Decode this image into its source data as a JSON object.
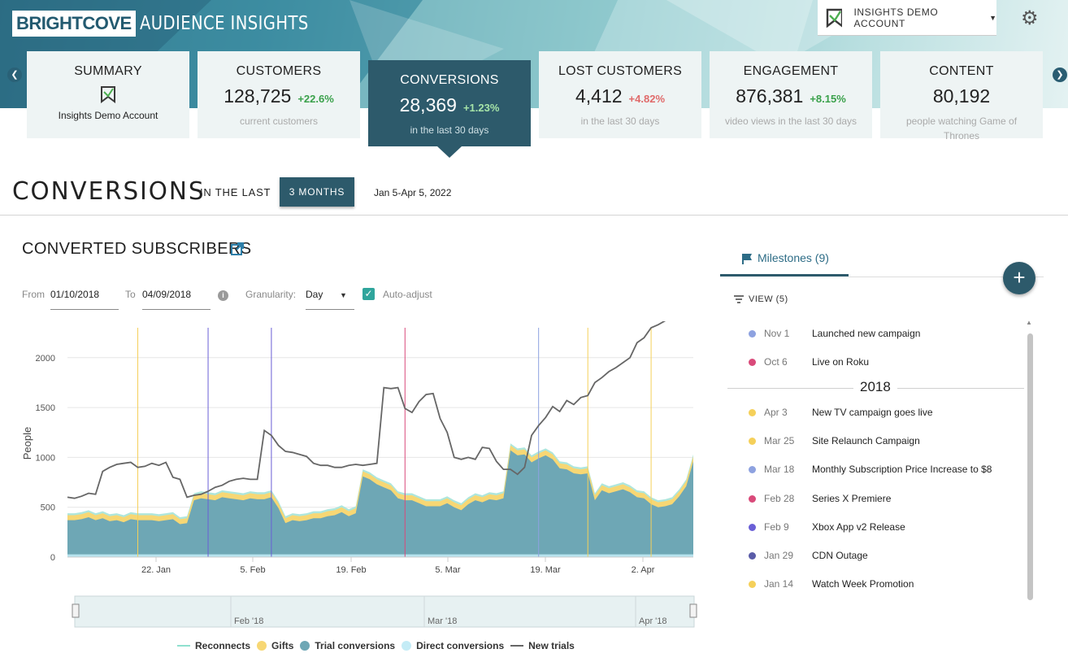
{
  "app": {
    "logo_brand": "BRIGHTCOVE",
    "logo_product": "AUDIENCE INSIGHTS",
    "account_label": "INSIGHTS DEMO ACCOUNT"
  },
  "cards": [
    {
      "title": "SUMMARY",
      "name": "Insights Demo Account"
    },
    {
      "title": "CUSTOMERS",
      "value": "128,725",
      "delta": "+22.6%",
      "sub": "current customers"
    },
    {
      "title": "CONVERSIONS",
      "value": "28,369",
      "delta": "+1.23%",
      "sub": "in the last 30 days"
    },
    {
      "title": "LOST CUSTOMERS",
      "value": "4,412",
      "delta": "+4.82%",
      "sub": "in the last 30 days"
    },
    {
      "title": "ENGAGEMENT",
      "value": "876,381",
      "delta": "+8.15%",
      "sub": "video views in the last 30 days"
    },
    {
      "title": "CONTENT",
      "value": "80,192",
      "sub": "people watching Game of Thrones"
    }
  ],
  "section": {
    "title": "CONVERSIONS",
    "in_the_last": "IN THE LAST",
    "period_button": "3 MONTHS",
    "date_range": "Jan 5-Apr 5, 2022"
  },
  "panel": {
    "title": "CONVERTED SUBSCRIBERS",
    "from_label": "From",
    "from_value": "01/10/2018",
    "to_label": "To",
    "to_value": "04/09/2018",
    "granularity_label": "Granularity:",
    "granularity_value": "Day",
    "auto_adjust_label": "Auto-adjust",
    "auto_adjust_checked": true
  },
  "chart_data": {
    "type": "area",
    "ylabel": "People",
    "ylim": [
      0,
      2300
    ],
    "y_ticks": [
      "0",
      "500",
      "1000",
      "1500",
      "2000"
    ],
    "x_ticks": [
      "22. Jan",
      "5. Feb",
      "19. Feb",
      "5. Mar",
      "19. Mar",
      "2. Apr"
    ],
    "navigator_labels": [
      "Feb '18",
      "Mar '18",
      "Apr '18"
    ],
    "x_start": "2018-01-10",
    "series": [
      {
        "name": "Reconnects",
        "color": "#aee6dc",
        "values": [
          20,
          20,
          20,
          20,
          20,
          20,
          20,
          20,
          20,
          20,
          20,
          20,
          20,
          20,
          20,
          20,
          20,
          20,
          20,
          20,
          20,
          20,
          20,
          20,
          20,
          20,
          20,
          20,
          20,
          20,
          20,
          20,
          20,
          20,
          20,
          20,
          20,
          20,
          20,
          20,
          20,
          20,
          20,
          20,
          20,
          20,
          20,
          20,
          20,
          20,
          20,
          20,
          20,
          20,
          20,
          20,
          20,
          20,
          20,
          20,
          20,
          20,
          20,
          20,
          20,
          20,
          20,
          20,
          20,
          20,
          20,
          20,
          20,
          20,
          20,
          20,
          20,
          20,
          20,
          20,
          20,
          20,
          20,
          20,
          20,
          20,
          20,
          20,
          20,
          20
        ]
      },
      {
        "name": "Gifts",
        "color": "#f7d774",
        "values": [
          50,
          50,
          50,
          50,
          50,
          50,
          50,
          50,
          50,
          50,
          50,
          50,
          50,
          50,
          50,
          50,
          50,
          50,
          50,
          50,
          50,
          50,
          50,
          50,
          50,
          50,
          50,
          50,
          50,
          50,
          50,
          50,
          50,
          50,
          50,
          50,
          50,
          50,
          50,
          50,
          50,
          50,
          50,
          50,
          50,
          50,
          50,
          50,
          50,
          50,
          50,
          50,
          50,
          50,
          50,
          50,
          50,
          50,
          50,
          50,
          50,
          50,
          50,
          50,
          50,
          50,
          50,
          50,
          50,
          50,
          50,
          50,
          50,
          50,
          50,
          50,
          50,
          50,
          50,
          50,
          50,
          50,
          50,
          50,
          50,
          50,
          50,
          50,
          50,
          50
        ]
      },
      {
        "name": "Trial conversions",
        "color": "#6ea7b5",
        "values": [
          360,
          360,
          370,
          390,
          360,
          380,
          350,
          360,
          340,
          370,
          360,
          360,
          360,
          350,
          360,
          370,
          320,
          330,
          560,
          580,
          570,
          560,
          590,
          580,
          570,
          560,
          580,
          570,
          570,
          590,
          480,
          330,
          360,
          350,
          360,
          380,
          380,
          400,
          410,
          440,
          400,
          430,
          800,
          770,
          720,
          690,
          660,
          580,
          560,
          560,
          530,
          500,
          500,
          500,
          530,
          490,
          460,
          520,
          560,
          540,
          570,
          560,
          580,
          1060,
          1010,
          1020,
          940,
          980,
          1010,
          970,
          880,
          870,
          830,
          820,
          830,
          560,
          660,
          630,
          650,
          670,
          640,
          590,
          580,
          520,
          490,
          500,
          520,
          600,
          700,
          950
        ]
      },
      {
        "name": "Direct conversions",
        "color": "#b7e3ee",
        "values": [
          10,
          10,
          10,
          10,
          10,
          10,
          10,
          10,
          10,
          10,
          10,
          10,
          10,
          10,
          10,
          10,
          10,
          10,
          10,
          10,
          10,
          10,
          10,
          10,
          10,
          10,
          10,
          10,
          10,
          10,
          10,
          10,
          10,
          10,
          10,
          10,
          10,
          10,
          10,
          10,
          10,
          10,
          10,
          10,
          10,
          10,
          10,
          10,
          10,
          10,
          10,
          10,
          10,
          10,
          10,
          10,
          10,
          10,
          10,
          10,
          10,
          10,
          10,
          10,
          10,
          10,
          10,
          10,
          10,
          10,
          10,
          10,
          10,
          10,
          10,
          10,
          10,
          10,
          10,
          10,
          10,
          10,
          10,
          10,
          10,
          10,
          10,
          10,
          10,
          10
        ]
      },
      {
        "name": "New trials",
        "color": "#666666",
        "values": [
          600,
          590,
          610,
          640,
          630,
          860,
          900,
          930,
          940,
          950,
          900,
          910,
          940,
          920,
          950,
          800,
          780,
          600,
          620,
          630,
          660,
          700,
          720,
          760,
          780,
          790,
          780,
          780,
          1270,
          1220,
          1120,
          1060,
          1050,
          1030,
          1010,
          940,
          920,
          920,
          900,
          900,
          920,
          930,
          920,
          930,
          940,
          1700,
          1690,
          1700,
          1490,
          1450,
          1560,
          1630,
          1640,
          1390,
          1250,
          1000,
          980,
          1000,
          980,
          1100,
          1090,
          960,
          880,
          880,
          830,
          900,
          1220,
          1320,
          1400,
          1510,
          1460,
          1570,
          1530,
          1600,
          1620,
          1750,
          1800,
          1860,
          1900,
          1950,
          2000,
          2150,
          2200,
          2300,
          2330,
          2370,
          2420,
          2460,
          2520,
          2570
        ]
      }
    ],
    "milestone_lines": [
      {
        "color": "#f5d05a",
        "x_index": 10
      },
      {
        "color": "#6a5fd6",
        "x_index": 20
      },
      {
        "color": "#6a5fd6",
        "x_index": 29
      },
      {
        "color": "#d94a7a",
        "x_index": 48
      },
      {
        "color": "#8ea2e0",
        "x_index": 67
      },
      {
        "color": "#f5d05a",
        "x_index": 74
      },
      {
        "color": "#f5d05a",
        "x_index": 83
      }
    ]
  },
  "legend": [
    {
      "label": "Reconnects",
      "kind": "line",
      "color": "#8fe0cf"
    },
    {
      "label": "Gifts",
      "kind": "dot",
      "color": "#f7d774"
    },
    {
      "label": "Trial conversions",
      "kind": "dot",
      "color": "#6ea7b5"
    },
    {
      "label": "Direct conversions",
      "kind": "dot",
      "color": "#c4ecf6"
    },
    {
      "label": "New trials",
      "kind": "line",
      "color": "#666666"
    }
  ],
  "milestones": {
    "tab_label": "Milestones (9)",
    "view_label": "VIEW (5)",
    "year_label": "2018",
    "items_before_year": [
      {
        "date": "Nov 1",
        "name": "Launched new campaign",
        "color": "#8ea2e0"
      },
      {
        "date": "Oct 6",
        "name": "Live on Roku",
        "color": "#d94a7a"
      }
    ],
    "items": [
      {
        "date": "Apr 3",
        "name": "New TV campaign goes live",
        "color": "#f5d05a"
      },
      {
        "date": "Mar 25",
        "name": "Site Relaunch Campaign",
        "color": "#f5d05a"
      },
      {
        "date": "Mar 18",
        "name": "Monthly Subscription Price Increase to $8",
        "color": "#8ea2e0"
      },
      {
        "date": "Feb 28",
        "name": "Series X Premiere",
        "color": "#d94a7a"
      },
      {
        "date": "Feb 9",
        "name": "Xbox App v2 Release",
        "color": "#6a5fd6"
      },
      {
        "date": "Jan 29",
        "name": "CDN Outage",
        "color": "#5a5ca8"
      },
      {
        "date": "Jan 14",
        "name": "Watch Week Promotion",
        "color": "#f5d05a"
      }
    ]
  }
}
